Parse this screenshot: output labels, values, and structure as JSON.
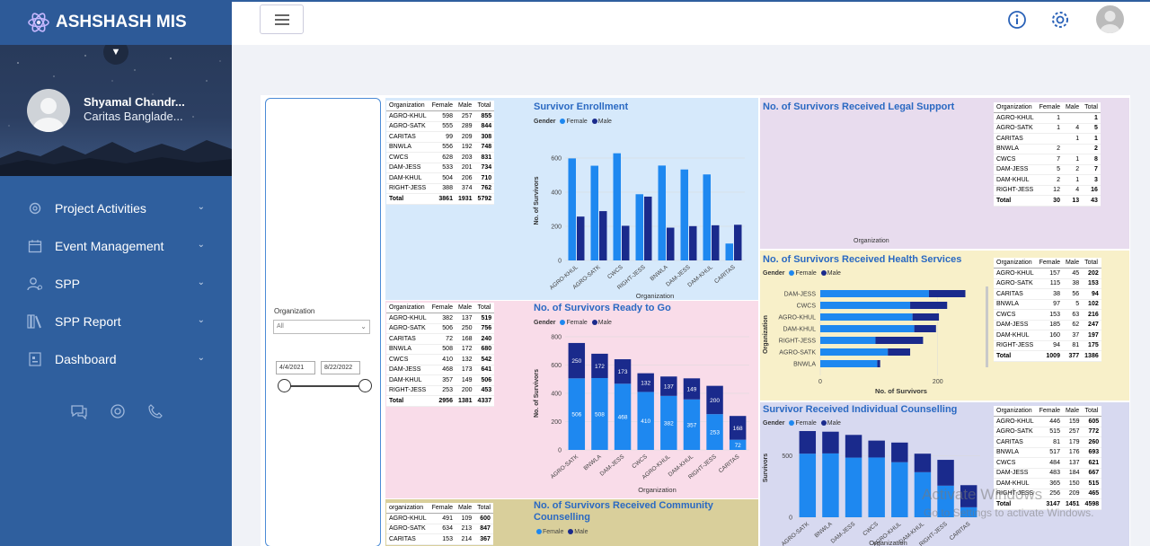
{
  "app": {
    "title": "ASHSHASH MIS"
  },
  "user": {
    "name": "Shyamal Chandr...",
    "org": "Caritas Banglade..."
  },
  "menu": {
    "items": [
      {
        "label": "Project Activities",
        "icon": "gear-icon"
      },
      {
        "label": "Event Management",
        "icon": "calendar-icon"
      },
      {
        "label": "SPP",
        "icon": "user-settings-icon"
      },
      {
        "label": "SPP Report",
        "icon": "books-icon"
      },
      {
        "label": "Dashboard",
        "icon": "dashboard-icon"
      }
    ]
  },
  "filter": {
    "label": "Organization",
    "select_value": "All",
    "date_from": "4/4/2021",
    "date_to": "8/22/2022"
  },
  "tables": {
    "enrollment": {
      "headers": [
        "Organization",
        "Female",
        "Male",
        "Total"
      ],
      "rows": [
        [
          "AGRO-KHUL",
          "598",
          "257",
          "855"
        ],
        [
          "AGRO-SATK",
          "555",
          "289",
          "844"
        ],
        [
          "CARITAS",
          "99",
          "209",
          "308"
        ],
        [
          "BNWLA",
          "556",
          "192",
          "748"
        ],
        [
          "CWCS",
          "628",
          "203",
          "831"
        ],
        [
          "DAM-JESS",
          "533",
          "201",
          "734"
        ],
        [
          "DAM-KHUL",
          "504",
          "206",
          "710"
        ],
        [
          "RIGHT-JESS",
          "388",
          "374",
          "762"
        ]
      ],
      "total": [
        "Total",
        "3861",
        "1931",
        "5792"
      ]
    },
    "ready": {
      "headers": [
        "Organization",
        "Female",
        "Male",
        "Total"
      ],
      "rows": [
        [
          "AGRO-KHUL",
          "382",
          "137",
          "519"
        ],
        [
          "AGRO-SATK",
          "506",
          "250",
          "756"
        ],
        [
          "CARITAS",
          "72",
          "168",
          "240"
        ],
        [
          "BNWLA",
          "508",
          "172",
          "680"
        ],
        [
          "CWCS",
          "410",
          "132",
          "542"
        ],
        [
          "DAM-JESS",
          "468",
          "173",
          "641"
        ],
        [
          "DAM-KHUL",
          "357",
          "149",
          "506"
        ],
        [
          "RIGHT-JESS",
          "253",
          "200",
          "453"
        ]
      ],
      "total": [
        "Total",
        "2956",
        "1381",
        "4337"
      ]
    },
    "community": {
      "headers": [
        "organization",
        "Female",
        "Male",
        "Total"
      ],
      "rows": [
        [
          "AGRO-KHUL",
          "491",
          "109",
          "600"
        ],
        [
          "AGRO-SATK",
          "634",
          "213",
          "847"
        ],
        [
          "CARITAS",
          "153",
          "214",
          "367"
        ]
      ]
    },
    "legal": {
      "headers": [
        "Organization",
        "Female",
        "Male",
        "Total"
      ],
      "rows": [
        [
          "AGRO-KHUL",
          "1",
          "",
          "1"
        ],
        [
          "AGRO-SATK",
          "1",
          "4",
          "5"
        ],
        [
          "CARITAS",
          "",
          "1",
          "1"
        ],
        [
          "BNWLA",
          "2",
          "",
          "2"
        ],
        [
          "CWCS",
          "7",
          "1",
          "8"
        ],
        [
          "DAM-JESS",
          "5",
          "2",
          "7"
        ],
        [
          "DAM-KHUL",
          "2",
          "1",
          "3"
        ],
        [
          "RIGHT-JESS",
          "12",
          "4",
          "16"
        ]
      ],
      "total": [
        "Total",
        "30",
        "13",
        "43"
      ]
    },
    "health": {
      "headers": [
        "Organization",
        "Female",
        "Male",
        "Total"
      ],
      "rows": [
        [
          "AGRO-KHUL",
          "157",
          "45",
          "202"
        ],
        [
          "AGRO-SATK",
          "115",
          "38",
          "153"
        ],
        [
          "CARITAS",
          "38",
          "56",
          "94"
        ],
        [
          "BNWLA",
          "97",
          "5",
          "102"
        ],
        [
          "CWCS",
          "153",
          "63",
          "216"
        ],
        [
          "DAM-JESS",
          "185",
          "62",
          "247"
        ],
        [
          "DAM-KHUL",
          "160",
          "37",
          "197"
        ],
        [
          "RIGHT-JESS",
          "94",
          "81",
          "175"
        ]
      ],
      "total": [
        "Total",
        "1009",
        "377",
        "1386"
      ]
    },
    "counselling": {
      "headers": [
        "Organization",
        "Female",
        "Male",
        "Total"
      ],
      "rows": [
        [
          "AGRO-KHUL",
          "446",
          "159",
          "605"
        ],
        [
          "AGRO-SATK",
          "515",
          "257",
          "772"
        ],
        [
          "CARITAS",
          "81",
          "179",
          "260"
        ],
        [
          "BNWLA",
          "517",
          "176",
          "693"
        ],
        [
          "CWCS",
          "484",
          "137",
          "621"
        ],
        [
          "DAM-JESS",
          "483",
          "184",
          "667"
        ],
        [
          "DAM-KHUL",
          "365",
          "150",
          "515"
        ],
        [
          "RIGHT-JESS",
          "256",
          "209",
          "465"
        ]
      ],
      "total": [
        "Total",
        "3147",
        "1451",
        "4598"
      ]
    }
  },
  "titles": {
    "enrollment": "Survivor Enrollment",
    "ready": "No. of Survivors Ready to Go",
    "community": "No. of Survivors Received Community Counselling",
    "legal": "No. of Survivors Received Legal Support",
    "health": "No. of Survivors Received Health Services",
    "counselling": "Survivor Received Individual Counselling"
  },
  "legend": {
    "title": "Gender",
    "female": "Female",
    "male": "Male"
  },
  "axis": {
    "survivors": "No. of Survivors",
    "survivors_short": "Survivors",
    "org": "Organization"
  },
  "colors": {
    "female": "#1e88f0",
    "male": "#1a2a8c"
  },
  "chart_data": [
    {
      "type": "bar",
      "title": "Survivor Enrollment",
      "categories": [
        "AGRO-KHUL",
        "AGRO-SATK",
        "CWCS",
        "RIGHT-JESS",
        "BNWLA",
        "DAM-JESS",
        "DAM-KHUL",
        "CARITAS"
      ],
      "series": [
        {
          "name": "Female",
          "values": [
            598,
            555,
            628,
            388,
            556,
            533,
            504,
            99
          ]
        },
        {
          "name": "Male",
          "values": [
            257,
            289,
            203,
            374,
            192,
            201,
            206,
            209
          ]
        }
      ],
      "ylim": [
        0,
        700
      ],
      "yticks": [
        0,
        200,
        400,
        600
      ],
      "xlabel": "Organization",
      "ylabel": "No. of Survivors"
    },
    {
      "type": "bar",
      "title": "No. of Survivors Ready to Go",
      "stacked": true,
      "categories": [
        "AGRO-SATK",
        "BNWLA",
        "DAM-JESS",
        "CWCS",
        "AGRO-KHUL",
        "DAM-KHUL",
        "RIGHT-JESS",
        "CARITAS"
      ],
      "series": [
        {
          "name": "Female",
          "values": [
            506,
            508,
            468,
            410,
            382,
            357,
            253,
            72
          ]
        },
        {
          "name": "Male",
          "values": [
            250,
            172,
            173,
            132,
            137,
            149,
            200,
            168
          ]
        }
      ],
      "ylim": [
        0,
        800
      ],
      "yticks": [
        0,
        200,
        400,
        600,
        800
      ],
      "xlabel": "Organization",
      "ylabel": "No. of Survivors"
    },
    {
      "type": "bar",
      "title": "No. of Survivors Received Health Services",
      "orientation": "horizontal",
      "stacked": true,
      "categories": [
        "DAM-JESS",
        "CWCS",
        "AGRO-KHUL",
        "DAM-KHUL",
        "RIGHT-JESS",
        "AGRO-SATK",
        "BNWLA"
      ],
      "series": [
        {
          "name": "Female",
          "values": [
            185,
            153,
            157,
            160,
            94,
            115,
            97
          ]
        },
        {
          "name": "Male",
          "values": [
            62,
            63,
            45,
            37,
            81,
            38,
            5
          ]
        }
      ],
      "xlim": [
        0,
        260
      ],
      "xticks": [
        0,
        200
      ],
      "xlabel": "No. of Survivors",
      "ylabel": "Organization"
    },
    {
      "type": "bar",
      "title": "Survivor Received Individual Counselling",
      "stacked": true,
      "categories": [
        "AGRO-SATK",
        "BNWLA",
        "DAM-JESS",
        "CWCS",
        "AGRO-KHUL",
        "DAM-KHUL",
        "RIGHT-JESS",
        "CARITAS"
      ],
      "series": [
        {
          "name": "Female",
          "values": [
            515,
            517,
            483,
            484,
            446,
            365,
            256,
            81
          ]
        },
        {
          "name": "Male",
          "values": [
            257,
            176,
            184,
            137,
            159,
            150,
            209,
            179
          ]
        }
      ],
      "ylim": [
        0,
        800
      ],
      "yticks": [
        0,
        500
      ],
      "xlabel": "Organization",
      "ylabel": "Survivors"
    }
  ],
  "watermark": {
    "line1": "Activate Windows",
    "line2": "Go to Settings to activate Windows."
  }
}
